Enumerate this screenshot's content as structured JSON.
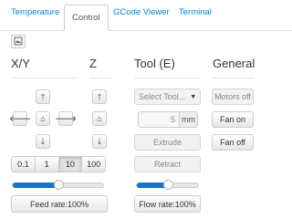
{
  "tabs": [
    {
      "label": "Temperature"
    },
    {
      "label": "Control"
    },
    {
      "label": "GCode Viewer"
    },
    {
      "label": "Terminal"
    }
  ],
  "active_tab": "Control",
  "sections": {
    "xy": {
      "title": "X/Y"
    },
    "z": {
      "title": "Z"
    },
    "tool": {
      "title": "Tool (E)"
    },
    "general": {
      "title": "General"
    }
  },
  "jog": {
    "step_options": [
      "0.1",
      "1",
      "10",
      "100"
    ],
    "selected_step": "10",
    "feed_rate_label": "Feed rate:100%",
    "feed_rate_value": 100
  },
  "tool": {
    "select_label": "Select Tool...",
    "amount_value": "5",
    "amount_unit": "mm",
    "extrude_label": "Extrude",
    "retract_label": "Retract",
    "flow_rate_label": "Flow rate:100%",
    "flow_rate_value": 100
  },
  "general": {
    "motors_off_label": "Motors off",
    "fan_on_label": "Fan on",
    "fan_off_label": "Fan off"
  },
  "icons": {
    "up": "arrow-up",
    "down": "arrow-down",
    "left": "arrow-left",
    "right": "arrow-right",
    "home": "home",
    "caret": "caret-down",
    "webcam_toggle": "image"
  },
  "colors": {
    "link": "#0088cc",
    "slider_fill": "#1a73c8"
  }
}
